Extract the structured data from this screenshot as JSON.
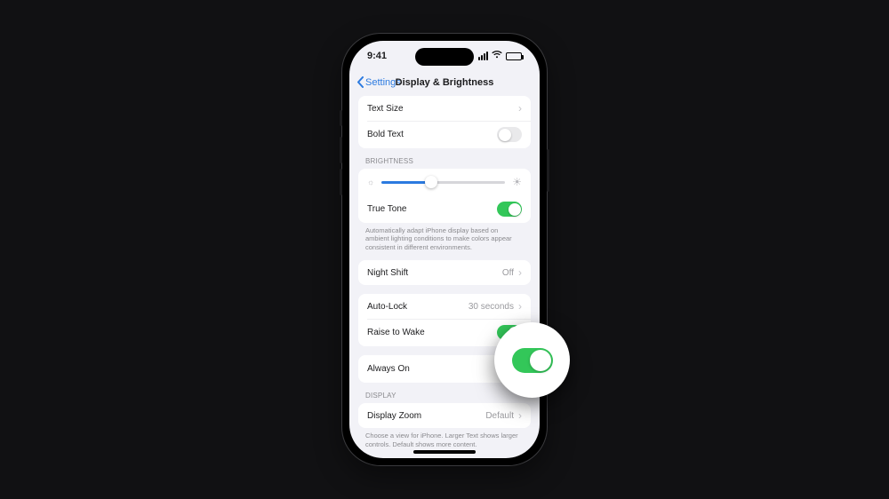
{
  "status": {
    "time": "9:41"
  },
  "nav": {
    "back": "Settings",
    "title": "Display & Brightness"
  },
  "text": {
    "size_label": "Text Size",
    "bold_label": "Bold Text",
    "bold_on": false
  },
  "brightness": {
    "header": "BRIGHTNESS",
    "level_pct": 40,
    "true_tone_label": "True Tone",
    "true_tone_on": true,
    "footer": "Automatically adapt iPhone display based on ambient lighting conditions to make colors appear consistent in different environments."
  },
  "night_shift": {
    "label": "Night Shift",
    "value": "Off"
  },
  "lock": {
    "auto_lock_label": "Auto-Lock",
    "auto_lock_value": "30 seconds",
    "raise_label": "Raise to Wake",
    "raise_on": true
  },
  "always_on": {
    "label": "Always On",
    "on": true
  },
  "display": {
    "header": "DISPLAY",
    "zoom_label": "Display Zoom",
    "zoom_value": "Default",
    "footer": "Choose a view for iPhone. Larger Text shows larger controls. Default shows more content."
  },
  "colors": {
    "ios_blue": "#2b7ae0",
    "ios_green": "#33c759",
    "ios_gray": "#8a8a8e"
  }
}
